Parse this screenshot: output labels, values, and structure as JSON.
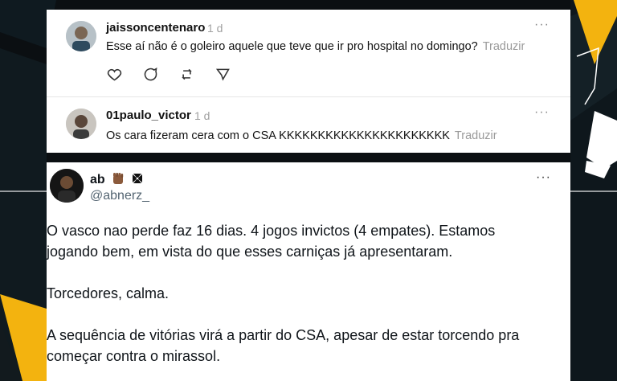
{
  "threads": {
    "comments": [
      {
        "username": "jaissoncentenaro",
        "time": "1 d",
        "text": "Esse aí não é o goleiro aquele que teve que ir pro hospital no domingo?",
        "translate_label": "Traduzir"
      },
      {
        "username": "01paulo_victor",
        "time": "1 d",
        "text": "Os cara fizeram cera com o CSA KKKKKKKKKKKKKKKKKKKKKK",
        "translate_label": "Traduzir"
      }
    ],
    "more_label": "···"
  },
  "tweet": {
    "display_name": "ab",
    "handle": "@abnerz_",
    "more_label": "···",
    "paragraphs": [
      "O vasco nao perde faz 16 dias. 4 jogos invictos (4 empates). Estamos",
      "jogando bem, em vista do que esses carniças já apresentaram.",
      "Torcedores, calma.",
      "A sequência de vitórias virá a partir do CSA, apesar de estar torcendo pra",
      "começar contra o mirassol."
    ]
  },
  "colors": {
    "accent_yellow": "#f3b30f",
    "background": "#0b0f12"
  }
}
